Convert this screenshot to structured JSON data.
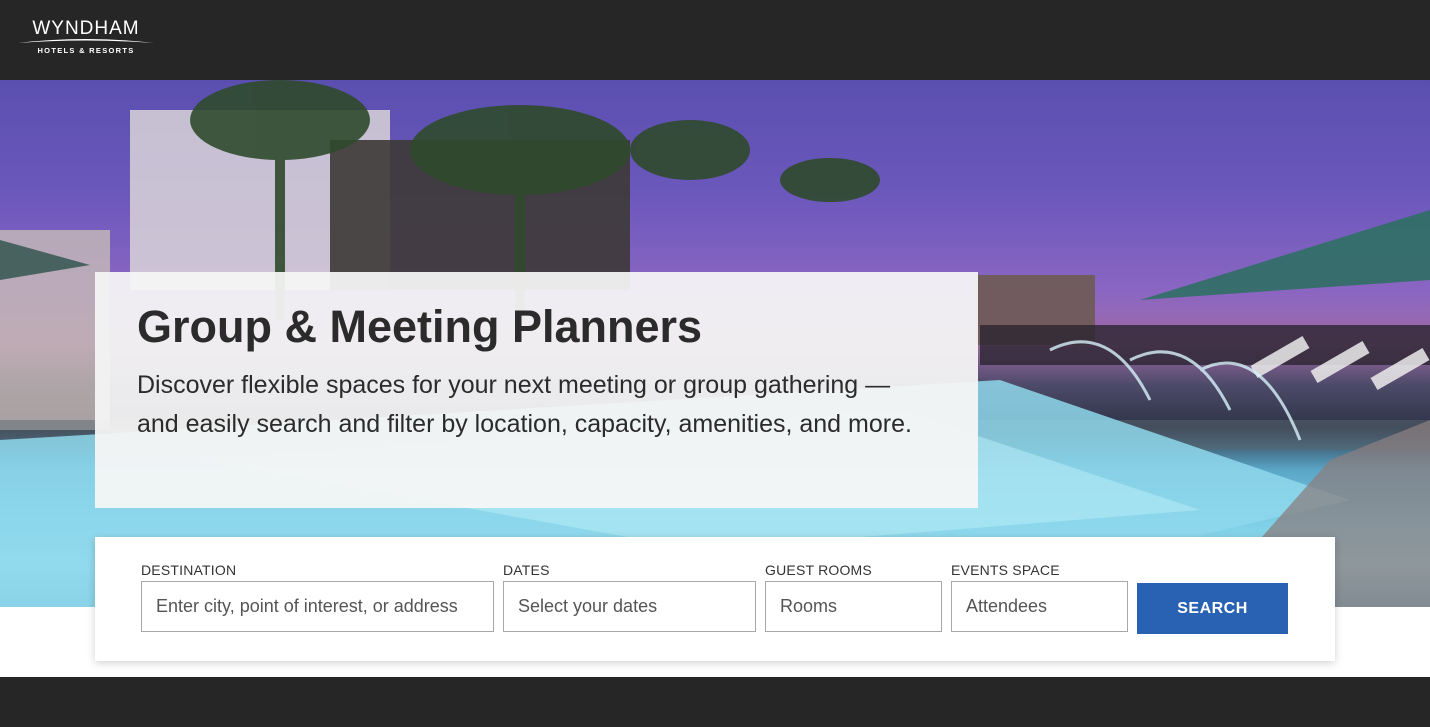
{
  "header": {
    "logo_word": "WYNDHAM",
    "logo_sub": "HOTELS & RESORTS"
  },
  "hero": {
    "title": "Group & Meeting Planners",
    "description": "Discover flexible spaces for your next meeting or group gathering — and easily search and filter by location, capacity, amenities, and more."
  },
  "search": {
    "destination": {
      "label": "DESTINATION",
      "placeholder": "Enter city, point of interest, or address",
      "value": ""
    },
    "dates": {
      "label": "DATES",
      "placeholder": "Select your dates",
      "value": ""
    },
    "guest_rooms": {
      "label": "GUEST ROOMS",
      "placeholder": "Rooms",
      "value": ""
    },
    "events_space": {
      "label": "EVENTS SPACE",
      "placeholder": "Attendees",
      "value": ""
    },
    "button_label": "SEARCH"
  },
  "colors": {
    "header_bg": "#262626",
    "accent": "#2a62b3"
  },
  "icons": [
    "wyndham-logo-swoosh-icon"
  ]
}
